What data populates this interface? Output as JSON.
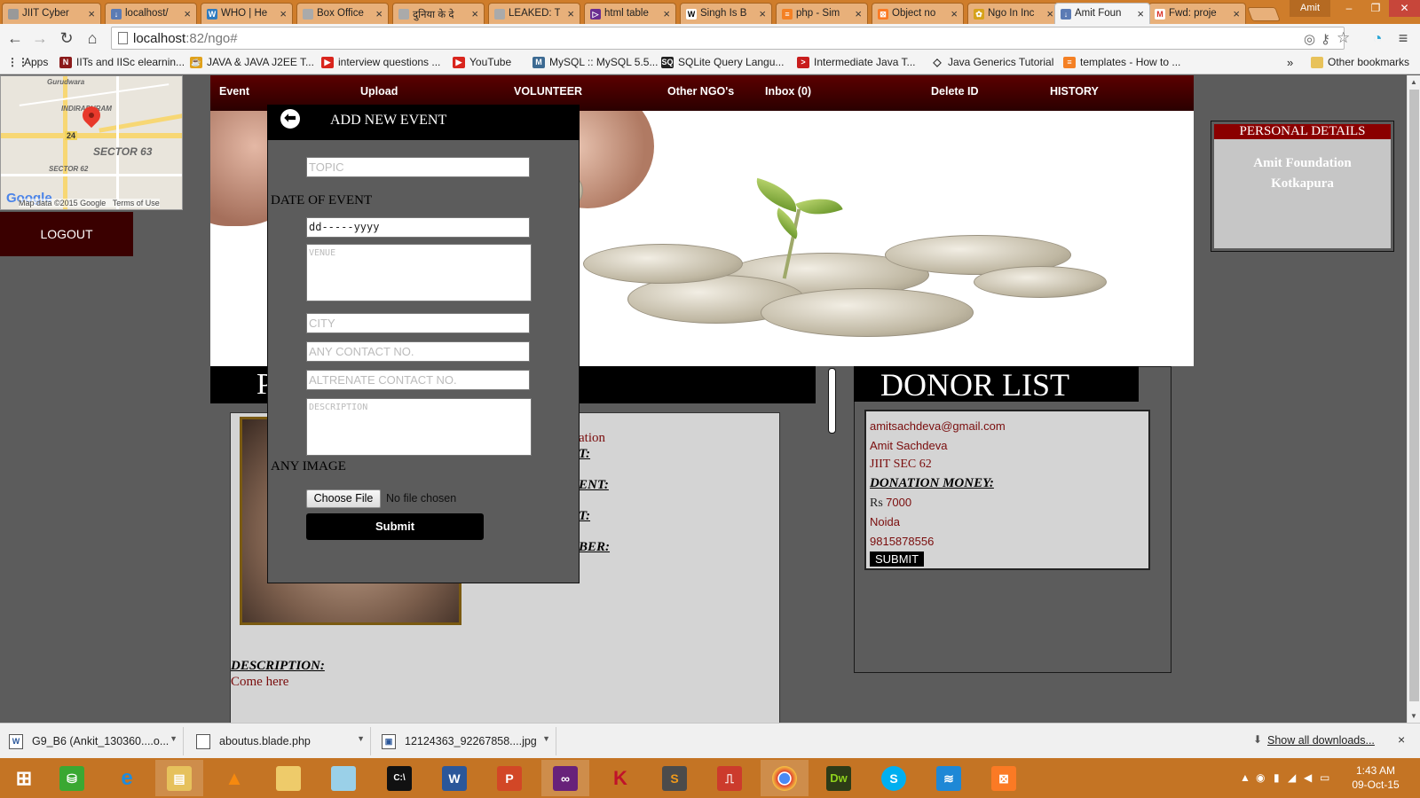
{
  "browser": {
    "tabs": [
      {
        "title": "JIIT Cyber",
        "icon": "page-icon"
      },
      {
        "title": "localhost/",
        "icon": "download-icon"
      },
      {
        "title": "WHO | He",
        "icon": "who-icon"
      },
      {
        "title": "Box Office",
        "icon": "page-icon"
      },
      {
        "title": "दुनिया के दे",
        "icon": "page-icon"
      },
      {
        "title": "LEAKED: T",
        "icon": "page-icon"
      },
      {
        "title": "html table",
        "icon": "vs-icon"
      },
      {
        "title": "Singh Is B",
        "icon": "wikipedia-icon"
      },
      {
        "title": "php - Sim",
        "icon": "stackoverflow-icon"
      },
      {
        "title": "Object no",
        "icon": "xampp-icon"
      },
      {
        "title": "Ngo In Inc",
        "icon": "ngo-icon"
      },
      {
        "title": "Amit Foun",
        "icon": "download-icon",
        "active": true
      },
      {
        "title": "Fwd: proje",
        "icon": "gmail-icon"
      }
    ],
    "user": "Amit",
    "url_host": "localhost",
    "url_path": ":82/ngo#",
    "bookmarks": [
      {
        "label": "Apps",
        "icon": "apps-icon"
      },
      {
        "label": "IITs and IISc elearnin...",
        "icon": "nptel-icon"
      },
      {
        "label": "JAVA & JAVA J2EE T...",
        "icon": "java-icon"
      },
      {
        "label": "interview questions ...",
        "icon": "youtube-icon"
      },
      {
        "label": "YouTube",
        "icon": "youtube-icon"
      },
      {
        "label": "MySQL :: MySQL 5.5...",
        "icon": "mysql-icon"
      },
      {
        "label": "SQLite Query Langu...",
        "icon": "sqlite-icon"
      },
      {
        "label": "Intermediate Java T...",
        "icon": "java-icon"
      },
      {
        "label": "Java Generics Tutorial",
        "icon": "generics-icon"
      },
      {
        "label": "templates - How to ...",
        "icon": "stackoverflow-icon"
      }
    ],
    "overflow": "»",
    "other_bookmarks": "Other bookmarks"
  },
  "sidebar": {
    "map": {
      "labels": [
        "Gurudwara",
        "INDIRAPURAM",
        "SECTOR 63",
        "SECTOR 62",
        "24"
      ],
      "credit": "Map data ©2015 Google",
      "terms": "Terms of Use",
      "logo": "Google"
    },
    "logout": "LOGOUT"
  },
  "nav": [
    "Event",
    "Upload",
    "VOLUNTEER",
    "Other NGO's",
    "Inbox (0)",
    "Delete ID",
    "HISTORY"
  ],
  "profile": {
    "header_initial": "P",
    "partial_lines": [
      "ation",
      "T:",
      "ENT:",
      "T:",
      "BER:"
    ],
    "description_label": "DESCRIPTION:",
    "description_value": "Come here"
  },
  "personal_details": {
    "title": "PERSONAL DETAILS",
    "name": "Amit Foundation",
    "city": "Kotkapura"
  },
  "donor_list": {
    "title": "DONOR LIST",
    "email": "amitsachdeva@gmail.com",
    "name": "Amit Sachdeva",
    "address": "JIIT SEC 62",
    "money_label": "DONATION MONEY:",
    "currency": "Rs",
    "amount": "7000",
    "city": "Noida",
    "phone": "9815878556",
    "submit": "SUBMIT"
  },
  "modal": {
    "title": "ADD NEW EVENT",
    "topic_placeholder": "TOPIC",
    "date_label": "DATE OF EVENT",
    "date_value": "dd-----yyyy",
    "venue_placeholder": "VENUE",
    "city_placeholder": "CITY",
    "contact_placeholder": "ANY CONTACT NO.",
    "alt_contact_placeholder": "ALTRENATE CONTACT NO.",
    "description_placeholder": "DESCRIPTION",
    "image_label": "ANY IMAGE",
    "choose_file": "Choose File",
    "no_file": "No file chosen",
    "submit": "Submit"
  },
  "downloads": {
    "items": [
      "G9_B6 (Ankit_130360....o...",
      "aboutus.blade.php",
      "12124363_92267858....jpg"
    ],
    "show_all": "Show all downloads...",
    "close": "×"
  },
  "taskbar": {
    "apps": [
      "start",
      "store",
      "ie",
      "explorer",
      "vlc",
      "folder",
      "tablet",
      "cmd",
      "word",
      "powerpoint",
      "visual-studio",
      "kaspersky",
      "sublime",
      "pdf",
      "chrome",
      "dreamweaver",
      "skype",
      "wifi",
      "xampp"
    ],
    "time": "1:43 AM",
    "date": "09-Oct-15"
  },
  "colors": {
    "nav_bar": "#3a0000",
    "personal_header": "#8a0000",
    "page_bg": "#5c5c5c",
    "tab_strip": "#cf7d2b",
    "taskbar": "#c47424"
  }
}
